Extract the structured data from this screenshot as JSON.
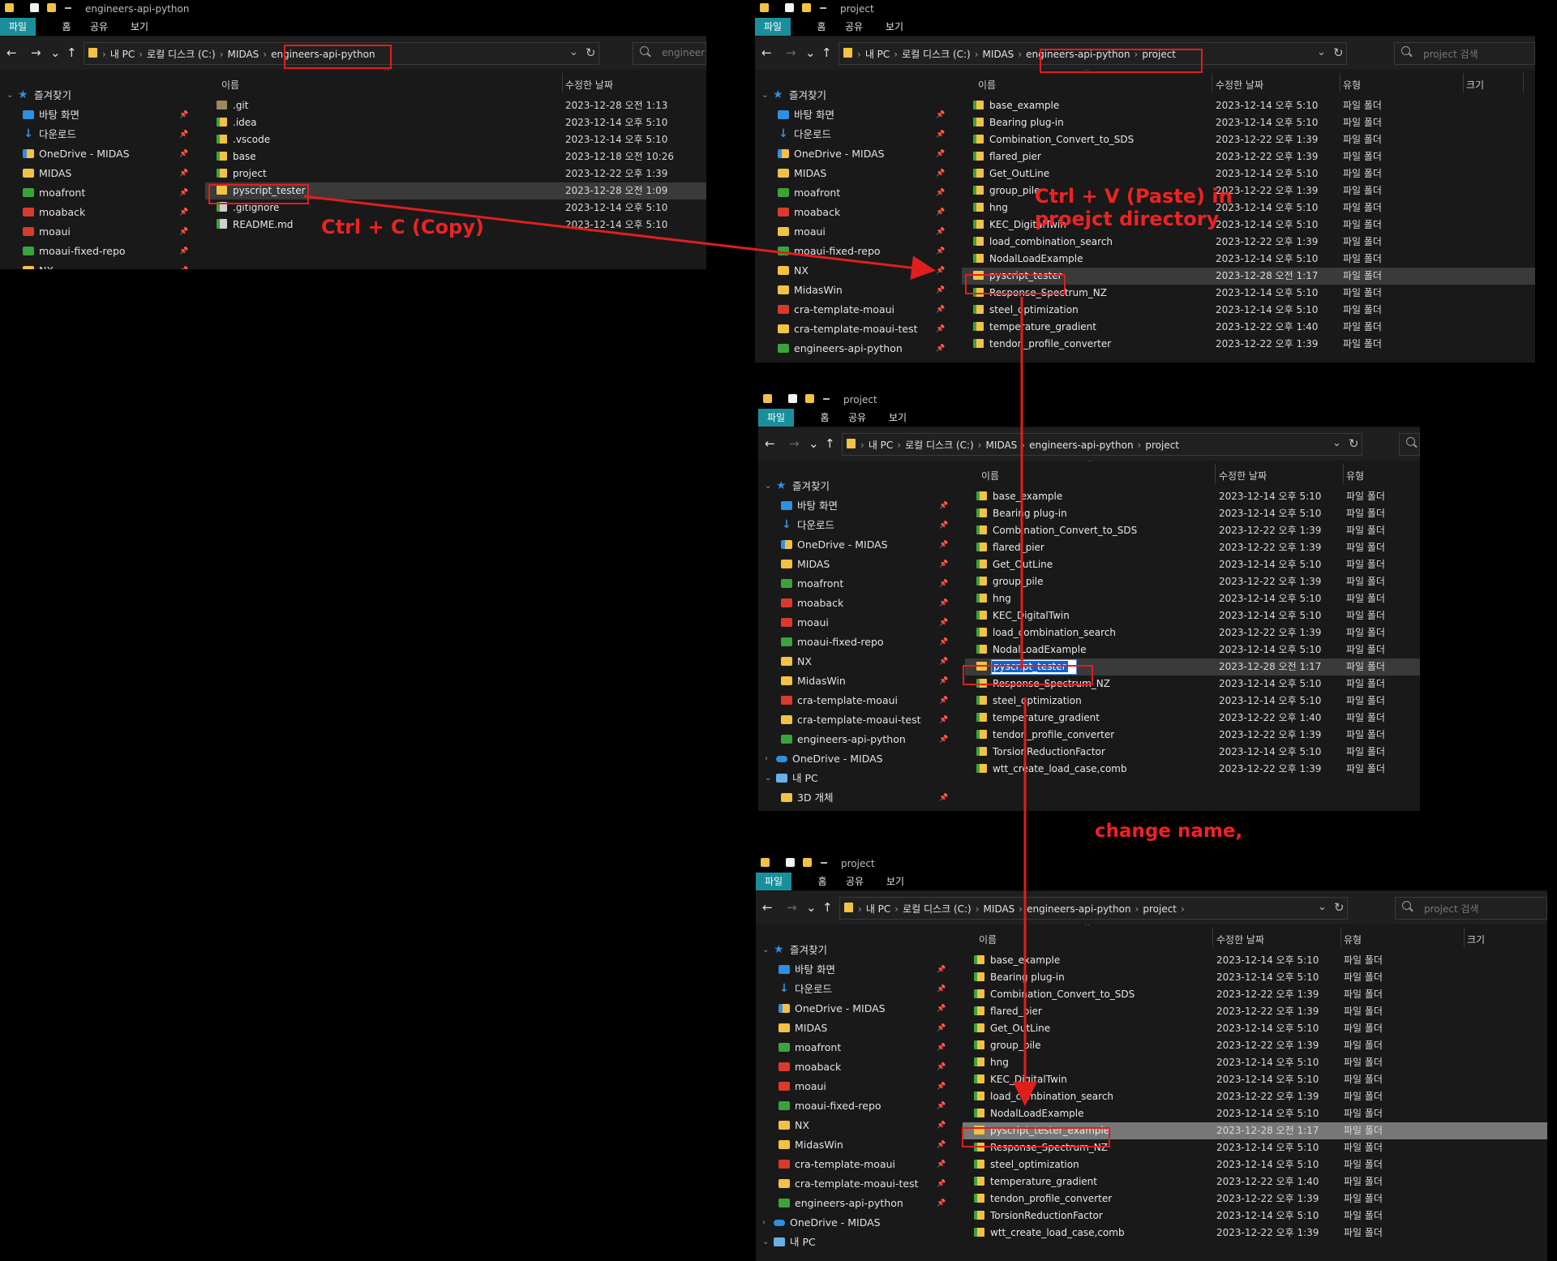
{
  "windows": [
    {
      "id": "w1",
      "title": "engineers-api-python",
      "ribbon": [
        "파일",
        "홈",
        "공유",
        "보기"
      ],
      "crumbs": [
        "내 PC",
        "로컬 디스크 (C:)",
        "MIDAS",
        "engineers-api-python"
      ],
      "search_placeholder": "engineers",
      "columns": [
        "이름",
        "수정한 날짜"
      ],
      "nav": [
        {
          "label": "즐겨찾기",
          "icon": "star-icon"
        },
        {
          "label": "바탕 화면",
          "icon": "desktop-icon"
        },
        {
          "label": "다운로드",
          "icon": "download-icon"
        },
        {
          "label": "OneDrive - MIDAS",
          "icon": "onedrive-folder-icon"
        },
        {
          "label": "MIDAS",
          "icon": "folder-icon"
        },
        {
          "label": "moafront",
          "icon": "git-folder-icon"
        },
        {
          "label": "moaback",
          "icon": "git-folder-red-icon"
        },
        {
          "label": "moaui",
          "icon": "git-folder-red-icon"
        },
        {
          "label": "moaui-fixed-repo",
          "icon": "git-folder-icon"
        },
        {
          "label": "NX",
          "icon": "folder-icon"
        }
      ],
      "rows": [
        {
          "name": ".git",
          "date": "2023-12-28 오전 1:13",
          "icon": "hidden-folder-icon"
        },
        {
          "name": ".idea",
          "date": "2023-12-14 오후 5:10",
          "icon": "git-folder-icon"
        },
        {
          "name": ".vscode",
          "date": "2023-12-14 오후 5:10",
          "icon": "git-folder-icon"
        },
        {
          "name": "base",
          "date": "2023-12-18 오전 10:26",
          "icon": "git-folder-icon"
        },
        {
          "name": "project",
          "date": "2023-12-22 오후 1:39",
          "icon": "git-folder-icon"
        },
        {
          "name": "pyscript_tester",
          "date": "2023-12-28 오전 1:09",
          "icon": "git-folder-icon"
        },
        {
          "name": ".gitignore",
          "date": "2023-12-14 오후 5:10",
          "icon": "git-file-icon"
        },
        {
          "name": "README.md",
          "date": "2023-12-14 오후 5:10",
          "icon": "git-file-icon"
        }
      ]
    },
    {
      "id": "w2",
      "title": "project",
      "ribbon": [
        "파일",
        "홈",
        "공유",
        "보기"
      ],
      "crumbs": [
        "내 PC",
        "로컬 디스크 (C:)",
        "MIDAS",
        "engineers-api-python",
        "project"
      ],
      "search_placeholder": "project 검색",
      "columns": [
        "이름",
        "수정한 날짜",
        "유형",
        "크기"
      ],
      "nav": [
        {
          "label": "즐겨찾기",
          "icon": "star-icon"
        },
        {
          "label": "바탕 화면",
          "icon": "desktop-icon"
        },
        {
          "label": "다운로드",
          "icon": "download-icon"
        },
        {
          "label": "OneDrive - MIDAS",
          "icon": "onedrive-folder-icon"
        },
        {
          "label": "MIDAS",
          "icon": "folder-icon"
        },
        {
          "label": "moafront",
          "icon": "git-folder-icon"
        },
        {
          "label": "moaback",
          "icon": "git-folder-red-icon"
        },
        {
          "label": "moaui",
          "icon": "folder-icon"
        },
        {
          "label": "moaui-fixed-repo",
          "icon": "git-folder-icon"
        },
        {
          "label": "NX",
          "icon": "folder-icon"
        },
        {
          "label": "MidasWin",
          "icon": "folder-icon"
        },
        {
          "label": "cra-template-moaui",
          "icon": "git-folder-red-icon"
        },
        {
          "label": "cra-template-moaui-test",
          "icon": "folder-icon"
        },
        {
          "label": "engineers-api-python",
          "icon": "git-folder-icon"
        }
      ],
      "rows": [
        {
          "name": "base_example",
          "date": "2023-12-14 오후 5:10",
          "type": "파일 폴더"
        },
        {
          "name": "Bearing plug-in",
          "date": "2023-12-14 오후 5:10",
          "type": "파일 폴더"
        },
        {
          "name": "Combination_Convert_to_SDS",
          "date": "2023-12-22 오후 1:39",
          "type": "파일 폴더"
        },
        {
          "name": "flared_pier",
          "date": "2023-12-22 오후 1:39",
          "type": "파일 폴더"
        },
        {
          "name": "Get_OutLine",
          "date": "2023-12-14 오후 5:10",
          "type": "파일 폴더"
        },
        {
          "name": "group_pile",
          "date": "2023-12-22 오후 1:39",
          "type": "파일 폴더"
        },
        {
          "name": "hng",
          "date": "2023-12-14 오후 5:10",
          "type": "파일 폴더"
        },
        {
          "name": "KEC_DigitalTwin",
          "date": "2023-12-14 오후 5:10",
          "type": "파일 폴더"
        },
        {
          "name": "load_combination_search",
          "date": "2023-12-22 오후 1:39",
          "type": "파일 폴더"
        },
        {
          "name": "NodalLoadExample",
          "date": "2023-12-14 오후 5:10",
          "type": "파일 폴더"
        },
        {
          "name": "pyscript_tester",
          "date": "2023-12-28 오전 1:17",
          "type": "파일 폴더"
        },
        {
          "name": "Response_Spectrum_NZ",
          "date": "2023-12-14 오후 5:10",
          "type": "파일 폴더"
        },
        {
          "name": "steel_optimization",
          "date": "2023-12-14 오후 5:10",
          "type": "파일 폴더"
        },
        {
          "name": "temperature_gradient",
          "date": "2023-12-22 오후 1:40",
          "type": "파일 폴더"
        },
        {
          "name": "tendon_profile_converter",
          "date": "2023-12-22 오후 1:39",
          "type": "파일 폴더"
        }
      ]
    },
    {
      "id": "w3",
      "title": "project",
      "ribbon": [
        "파일",
        "홈",
        "공유",
        "보기"
      ],
      "crumbs": [
        "내 PC",
        "로컬 디스크 (C:)",
        "MIDAS",
        "engineers-api-python",
        "project"
      ],
      "search_placeholder": "",
      "columns": [
        "이름",
        "수정한 날짜",
        "유형"
      ],
      "nav": [
        {
          "label": "즐겨찾기",
          "icon": "star-icon"
        },
        {
          "label": "바탕 화면",
          "icon": "desktop-icon"
        },
        {
          "label": "다운로드",
          "icon": "download-icon"
        },
        {
          "label": "OneDrive - MIDAS",
          "icon": "onedrive-folder-icon"
        },
        {
          "label": "MIDAS",
          "icon": "folder-icon"
        },
        {
          "label": "moafront",
          "icon": "git-folder-icon"
        },
        {
          "label": "moaback",
          "icon": "git-folder-red-icon"
        },
        {
          "label": "moaui",
          "icon": "git-folder-red-icon"
        },
        {
          "label": "moaui-fixed-repo",
          "icon": "git-folder-icon"
        },
        {
          "label": "NX",
          "icon": "folder-icon"
        },
        {
          "label": "MidasWin",
          "icon": "folder-icon"
        },
        {
          "label": "cra-template-moaui",
          "icon": "git-folder-red-icon"
        },
        {
          "label": "cra-template-moaui-test",
          "icon": "folder-icon"
        },
        {
          "label": "engineers-api-python",
          "icon": "git-folder-icon"
        },
        {
          "label": "OneDrive - MIDAS",
          "icon": "cloud-icon"
        },
        {
          "label": "내 PC",
          "icon": "pc-icon"
        },
        {
          "label": "3D 개체",
          "icon": "folder-icon"
        }
      ],
      "rows": [
        {
          "name": "base_example",
          "date": "2023-12-14 오후 5:10",
          "type": "파일 폴더"
        },
        {
          "name": "Bearing plug-in",
          "date": "2023-12-14 오후 5:10",
          "type": "파일 폴더"
        },
        {
          "name": "Combination_Convert_to_SDS",
          "date": "2023-12-22 오후 1:39",
          "type": "파일 폴더"
        },
        {
          "name": "flared_pier",
          "date": "2023-12-22 오후 1:39",
          "type": "파일 폴더"
        },
        {
          "name": "Get_OutLine",
          "date": "2023-12-14 오후 5:10",
          "type": "파일 폴더"
        },
        {
          "name": "group_pile",
          "date": "2023-12-22 오후 1:39",
          "type": "파일 폴더"
        },
        {
          "name": "hng",
          "date": "2023-12-14 오후 5:10",
          "type": "파일 폴더"
        },
        {
          "name": "KEC_DigitalTwin",
          "date": "2023-12-14 오후 5:10",
          "type": "파일 폴더"
        },
        {
          "name": "load_combination_search",
          "date": "2023-12-22 오후 1:39",
          "type": "파일 폴더"
        },
        {
          "name": "NodalLoadExample",
          "date": "2023-12-14 오후 5:10",
          "type": "파일 폴더"
        },
        {
          "name": "pyscript_tester",
          "date": "2023-12-28 오전 1:17",
          "type": "파일 폴더"
        },
        {
          "name": "Response_Spectrum_NZ",
          "date": "2023-12-14 오후 5:10",
          "type": "파일 폴더"
        },
        {
          "name": "steel_optimization",
          "date": "2023-12-14 오후 5:10",
          "type": "파일 폴더"
        },
        {
          "name": "temperature_gradient",
          "date": "2023-12-22 오후 1:40",
          "type": "파일 폴더"
        },
        {
          "name": "tendon_profile_converter",
          "date": "2023-12-22 오후 1:39",
          "type": "파일 폴더"
        },
        {
          "name": "TorsionReductionFactor",
          "date": "2023-12-14 오후 5:10",
          "type": "파일 폴더"
        },
        {
          "name": "wtt_create_load_case,comb",
          "date": "2023-12-22 오후 1:39",
          "type": "파일 폴더"
        }
      ]
    },
    {
      "id": "w4",
      "title": "project",
      "ribbon": [
        "파일",
        "홈",
        "공유",
        "보기"
      ],
      "crumbs": [
        "내 PC",
        "로컬 디스크 (C:)",
        "MIDAS",
        "engineers-api-python",
        "project"
      ],
      "search_placeholder": "project 검색",
      "columns": [
        "이름",
        "수정한 날짜",
        "유형",
        "크기"
      ],
      "nav": [
        {
          "label": "즐겨찾기",
          "icon": "star-icon"
        },
        {
          "label": "바탕 화면",
          "icon": "desktop-icon"
        },
        {
          "label": "다운로드",
          "icon": "download-icon"
        },
        {
          "label": "OneDrive - MIDAS",
          "icon": "onedrive-folder-icon"
        },
        {
          "label": "MIDAS",
          "icon": "folder-icon"
        },
        {
          "label": "moafront",
          "icon": "git-folder-icon"
        },
        {
          "label": "moaback",
          "icon": "git-folder-red-icon"
        },
        {
          "label": "moaui",
          "icon": "git-folder-red-icon"
        },
        {
          "label": "moaui-fixed-repo",
          "icon": "git-folder-icon"
        },
        {
          "label": "NX",
          "icon": "folder-icon"
        },
        {
          "label": "MidasWin",
          "icon": "folder-icon"
        },
        {
          "label": "cra-template-moaui",
          "icon": "git-folder-red-icon"
        },
        {
          "label": "cra-template-moaui-test",
          "icon": "folder-icon"
        },
        {
          "label": "engineers-api-python",
          "icon": "git-folder-icon"
        },
        {
          "label": "OneDrive - MIDAS",
          "icon": "cloud-icon"
        },
        {
          "label": "내 PC",
          "icon": "pc-icon"
        }
      ],
      "rows": [
        {
          "name": "base_example",
          "date": "2023-12-14 오후 5:10",
          "type": "파일 폴더"
        },
        {
          "name": "Bearing plug-in",
          "date": "2023-12-14 오후 5:10",
          "type": "파일 폴더"
        },
        {
          "name": "Combination_Convert_to_SDS",
          "date": "2023-12-22 오후 1:39",
          "type": "파일 폴더"
        },
        {
          "name": "flared_pier",
          "date": "2023-12-22 오후 1:39",
          "type": "파일 폴더"
        },
        {
          "name": "Get_OutLine",
          "date": "2023-12-14 오후 5:10",
          "type": "파일 폴더"
        },
        {
          "name": "group_pile",
          "date": "2023-12-22 오후 1:39",
          "type": "파일 폴더"
        },
        {
          "name": "hng",
          "date": "2023-12-14 오후 5:10",
          "type": "파일 폴더"
        },
        {
          "name": "KEC_DigitalTwin",
          "date": "2023-12-14 오후 5:10",
          "type": "파일 폴더"
        },
        {
          "name": "load_combination_search",
          "date": "2023-12-22 오후 1:39",
          "type": "파일 폴더"
        },
        {
          "name": "NodalLoadExample",
          "date": "2023-12-14 오후 5:10",
          "type": "파일 폴더"
        },
        {
          "name": "pyscript_tester_example",
          "date": "2023-12-28 오전 1:17",
          "type": "파일 폴더"
        },
        {
          "name": "Response_Spectrum_NZ",
          "date": "2023-12-14 오후 5:10",
          "type": "파일 폴더"
        },
        {
          "name": "steel_optimization",
          "date": "2023-12-14 오후 5:10",
          "type": "파일 폴더"
        },
        {
          "name": "temperature_gradient",
          "date": "2023-12-22 오후 1:40",
          "type": "파일 폴더"
        },
        {
          "name": "tendon_profile_converter",
          "date": "2023-12-22 오후 1:39",
          "type": "파일 폴더"
        },
        {
          "name": "TorsionReductionFactor",
          "date": "2023-12-14 오후 5:10",
          "type": "파일 폴더"
        },
        {
          "name": "wtt_create_load_case,comb",
          "date": "2023-12-22 오후 1:39",
          "type": "파일 폴더"
        }
      ]
    }
  ],
  "annotations": {
    "copy": "Ctrl + C (Copy)",
    "paste_line1": "Ctrl + V (Paste) in",
    "paste_line2": "proejct directory",
    "rename": "change name,"
  },
  "colors": {
    "annotation_red": "#e01e1e",
    "ribbon_active": "#1a8f9c",
    "window_bg": "#191919"
  }
}
